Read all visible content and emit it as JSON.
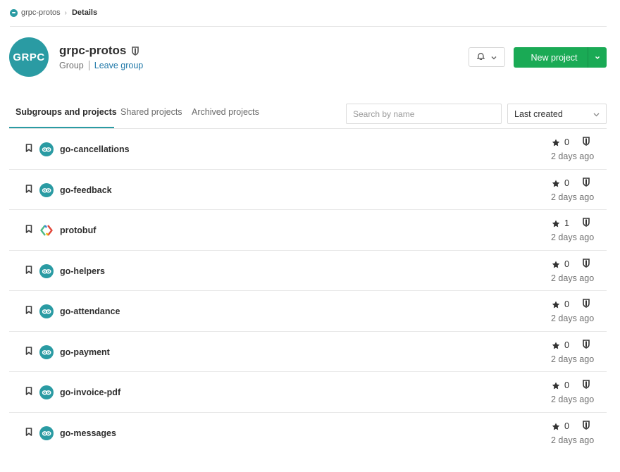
{
  "breadcrumb": {
    "group": "grpc-protos",
    "current": "Details"
  },
  "group": {
    "avatar_text": "GRPC",
    "name": "grpc-protos",
    "type": "Group",
    "leave_label": "Leave group",
    "visibility_icon": "shield-icon"
  },
  "header": {
    "notification_icon": "bell-icon",
    "new_project_label": "New project"
  },
  "tabs": [
    {
      "label": "Subgroups and projects",
      "active": true
    },
    {
      "label": "Shared projects",
      "active": false
    },
    {
      "label": "Archived projects",
      "active": false
    }
  ],
  "search": {
    "placeholder": "Search by name",
    "value": ""
  },
  "sort": {
    "selected": "Last created"
  },
  "colors": {
    "accent": "#2a9ba3",
    "primary_button": "#1aaa55",
    "link": "#1f78a8"
  },
  "projects": [
    {
      "name": "go-cancellations",
      "avatar": "go",
      "stars": "0",
      "updated": "2 days ago"
    },
    {
      "name": "go-feedback",
      "avatar": "go",
      "stars": "0",
      "updated": "2 days ago"
    },
    {
      "name": "protobuf",
      "avatar": "protobuf",
      "stars": "1",
      "updated": "2 days ago"
    },
    {
      "name": "go-helpers",
      "avatar": "go",
      "stars": "0",
      "updated": "2 days ago"
    },
    {
      "name": "go-attendance",
      "avatar": "go",
      "stars": "0",
      "updated": "2 days ago"
    },
    {
      "name": "go-payment",
      "avatar": "go",
      "stars": "0",
      "updated": "2 days ago"
    },
    {
      "name": "go-invoice-pdf",
      "avatar": "go",
      "stars": "0",
      "updated": "2 days ago"
    },
    {
      "name": "go-messages",
      "avatar": "go",
      "stars": "0",
      "updated": "2 days ago"
    }
  ]
}
